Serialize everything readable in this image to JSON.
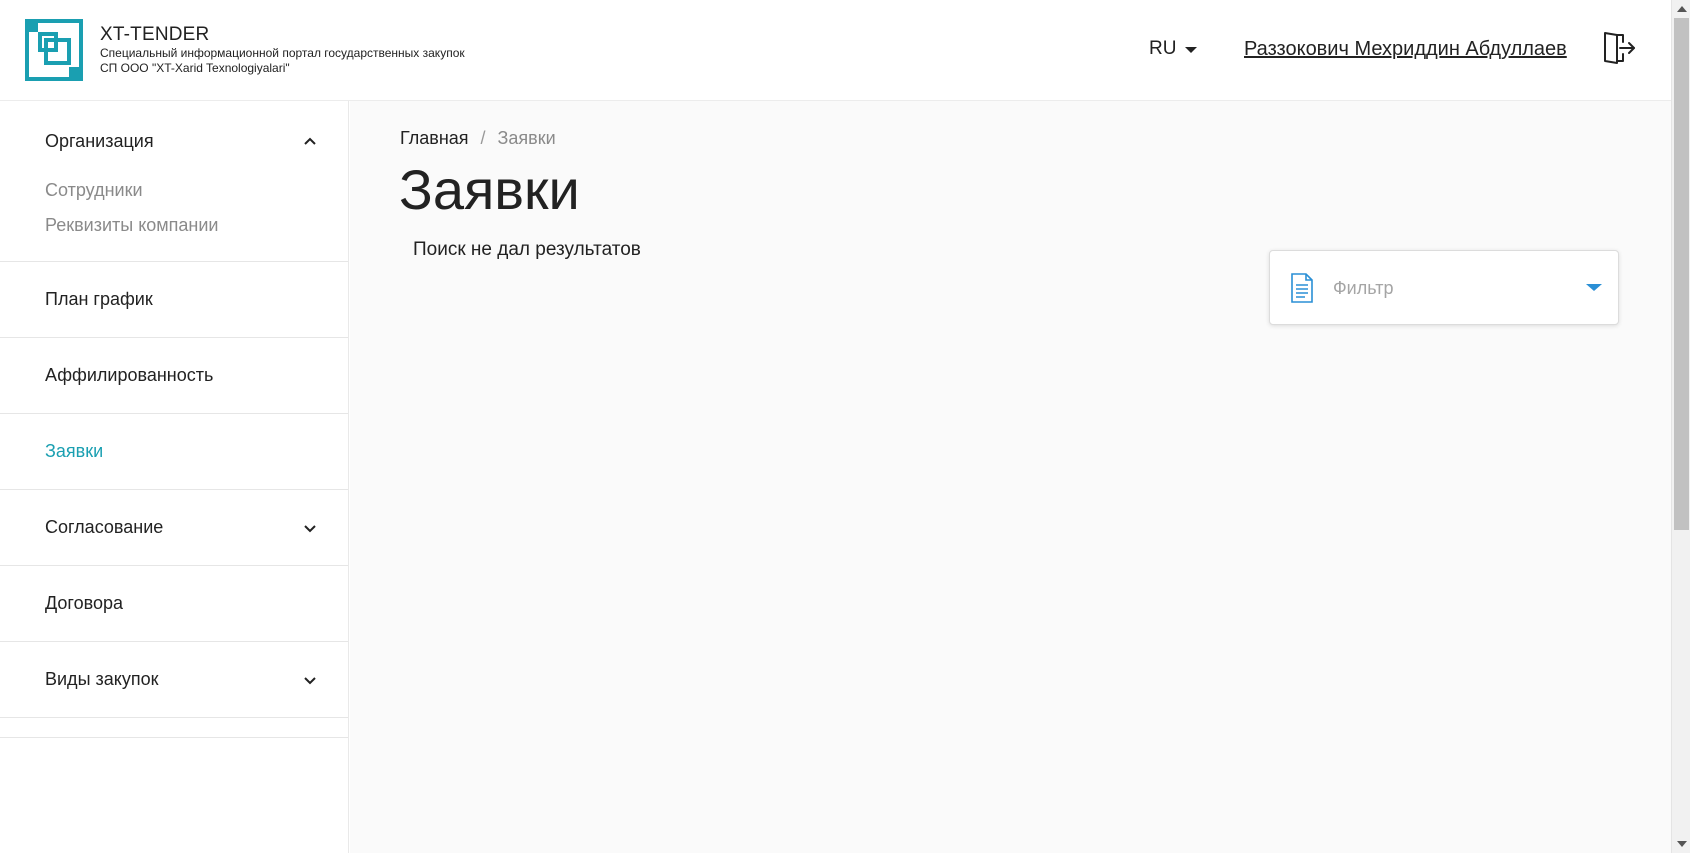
{
  "header": {
    "brand_title": "XT-TENDER",
    "brand_subtitle": "Специальный информационной портал государственных закупок",
    "brand_company": "СП ООО \"XT-Xarid Texnologiyalari\"",
    "language": "RU",
    "user_name": "Раззокович Мехриддин Абдуллаев",
    "logout_icon": "logout-icon"
  },
  "sidebar": {
    "organization": {
      "label": "Организация",
      "children": [
        "Сотрудники",
        "Реквизиты компании"
      ]
    },
    "items": [
      {
        "label": "План график"
      },
      {
        "label": "Аффилированность"
      },
      {
        "label": "Заявки",
        "active": true
      },
      {
        "label": "Согласование",
        "expandable": true
      },
      {
        "label": "Договора"
      },
      {
        "label": "Виды закупок",
        "expandable": true
      }
    ]
  },
  "main": {
    "breadcrumb": {
      "home": "Главная",
      "separator": "/",
      "current": "Заявки"
    },
    "title": "Заявки",
    "empty_message": "Поиск не дал результатов",
    "filter": {
      "placeholder": "Фильтр",
      "icon": "document-icon"
    }
  },
  "colors": {
    "accent": "#1a9fb1",
    "filter_caret": "#2a8fd5",
    "muted": "#8a8a8a"
  }
}
